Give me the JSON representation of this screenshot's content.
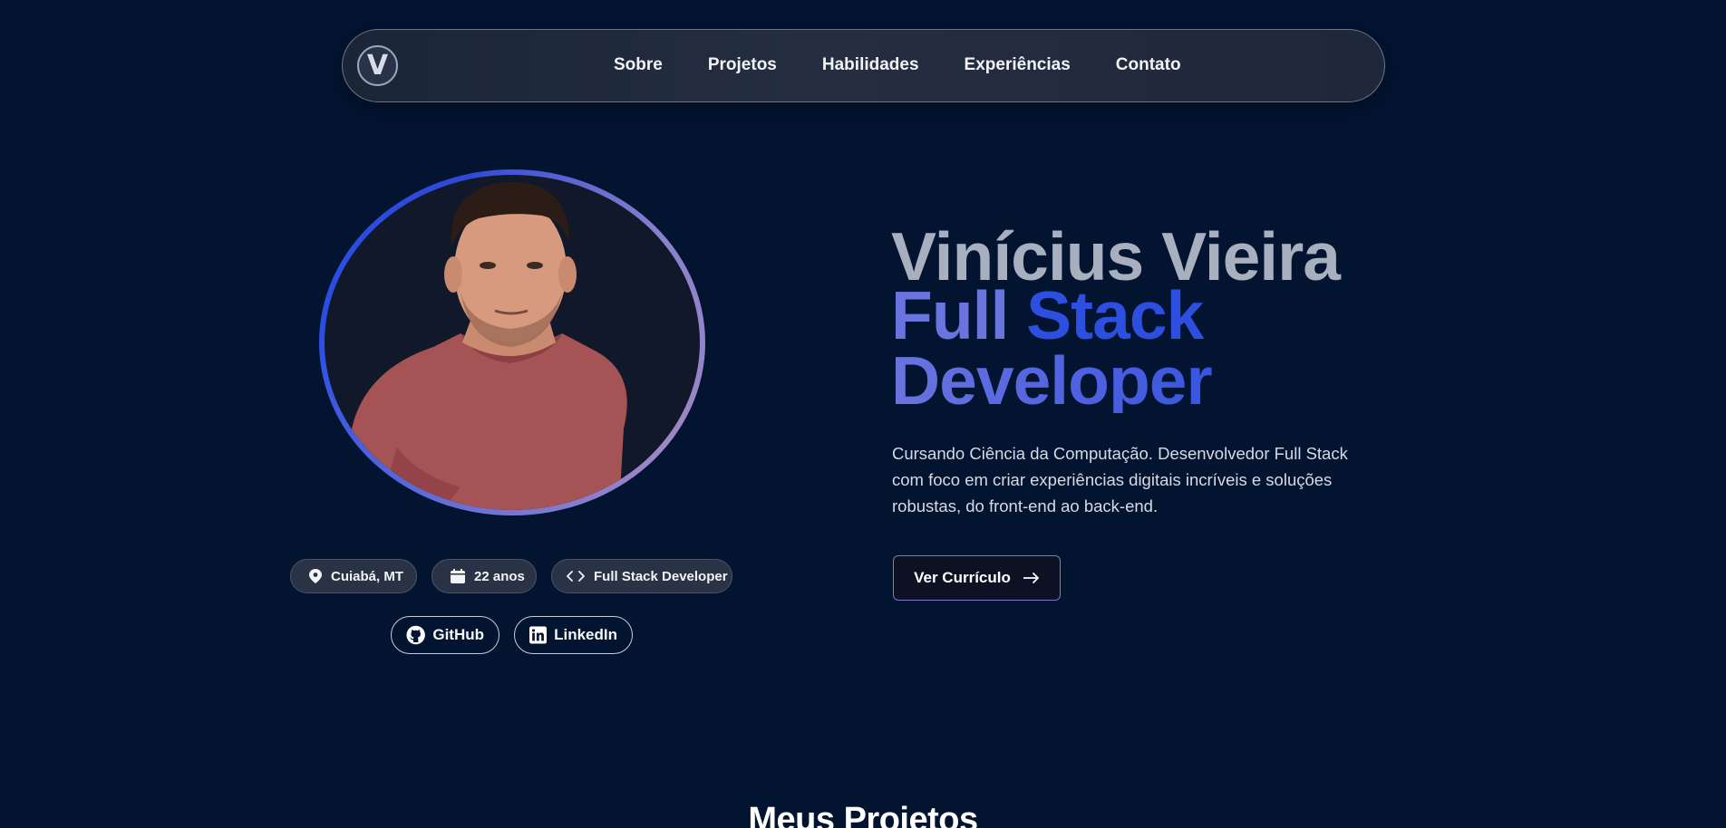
{
  "nav": {
    "logo_letter": "V",
    "links": [
      "Sobre",
      "Projetos",
      "Habilidades",
      "Experiências",
      "Contato"
    ]
  },
  "hero": {
    "name": "Vinícius Vieira",
    "role_line1_word1": "Full",
    "role_line1_word2": "Stack",
    "role_line2": "Developer",
    "description": "Cursando Ciência da Computação. Desenvolvedor Full Stack com foco em criar experiências digitais incríveis e soluções robustas, do front-end ao back-end.",
    "cta_label": "Ver Currículo"
  },
  "info_chips": {
    "location": "Cuiabá, MT",
    "age": "22 anos",
    "role": "Full Stack Developer"
  },
  "social": {
    "github": "GitHub",
    "linkedin": "LinkedIn"
  },
  "next_section_title": "Meus Projetos",
  "icons": {
    "location": "map-pin-icon",
    "age": "calendar-icon",
    "role": "code-icon",
    "github": "github-icon",
    "linkedin": "linkedin-icon",
    "cta": "arrow-right-icon"
  },
  "colors": {
    "background": "#031431",
    "name": "#a8b0bf",
    "accent_purple": "#6a74de",
    "accent_blue": "#2c4fe0"
  }
}
